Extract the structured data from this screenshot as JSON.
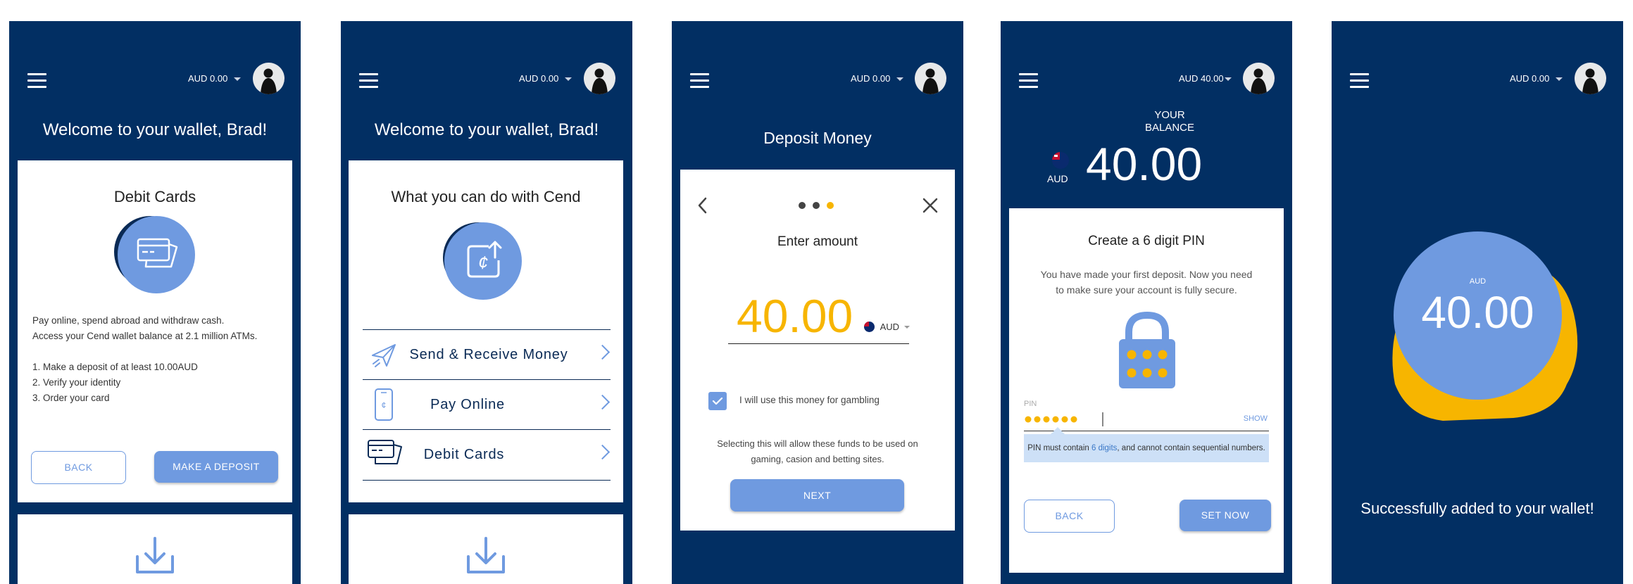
{
  "colors": {
    "navy": "#022f63",
    "accent_blue": "#6f9ae0",
    "amber": "#f7b500",
    "white": "#ffffff"
  },
  "screen1": {
    "balance": "AUD 0.00",
    "welcome": "Welcome to your wallet, Brad!",
    "card_title": "Debit Cards",
    "icon": "debit-cards-icon",
    "desc_line1": "Pay online, spend abroad and withdraw cash.",
    "desc_line2": "Access your Cend wallet balance at 2.1 million ATMs.",
    "steps": [
      "1. Make a deposit of at least 10.00AUD",
      "2. Verify your identity",
      "3. Order your card"
    ],
    "back_label": "BACK",
    "deposit_label": "MAKE A DEPOSIT",
    "bottom_icon": "download-icon"
  },
  "screen2": {
    "balance": "AUD 0.00",
    "welcome": "Welcome to your wallet, Brad!",
    "card_title": "What you can do with Cend",
    "icon": "cend-coin-upload-icon",
    "features": [
      {
        "label": "Send & Receive Money",
        "icon": "paper-plane-icon"
      },
      {
        "label": "Pay Online",
        "icon": "phone-icon"
      },
      {
        "label": "Debit Cards",
        "icon": "debit-cards-icon"
      }
    ],
    "bottom_icon": "download-icon"
  },
  "screen3": {
    "balance": "AUD 0.00",
    "title": "Deposit Money",
    "step_label": "Enter amount",
    "amount": "40.00",
    "currency": "AUD",
    "checkbox_checked": true,
    "checkbox_label": "I will use this money for gambling",
    "helper_line1": "Selecting this will allow these funds to be used on",
    "helper_line2": "gaming, casion and betting sites.",
    "next_label": "NEXT",
    "progress_dots": 3,
    "active_dot": 3
  },
  "screen4": {
    "balance": "AUD 40.00",
    "your_balance_line1": "YOUR",
    "your_balance_line2": "BALANCE",
    "currency": "AUD",
    "amount": "40.00",
    "pin_title": "Create a 6 digit PIN",
    "pin_desc_line1": "You have made your first deposit. Now you need",
    "pin_desc_line2": "to make sure your account is fully secure.",
    "pin_label": "PIN",
    "show_label": "SHOW",
    "pin_digits_entered": 6,
    "hint_prefix": "PIN must contain ",
    "hint_link": "6 digits",
    "hint_suffix": ", and cannot contain sequential numbers.",
    "back_label": "BACK",
    "set_label": "SET NOW"
  },
  "screen5": {
    "balance": "AUD 0.00",
    "currency": "AUD",
    "amount": "40.00",
    "success": "Successfully added to your wallet!"
  }
}
